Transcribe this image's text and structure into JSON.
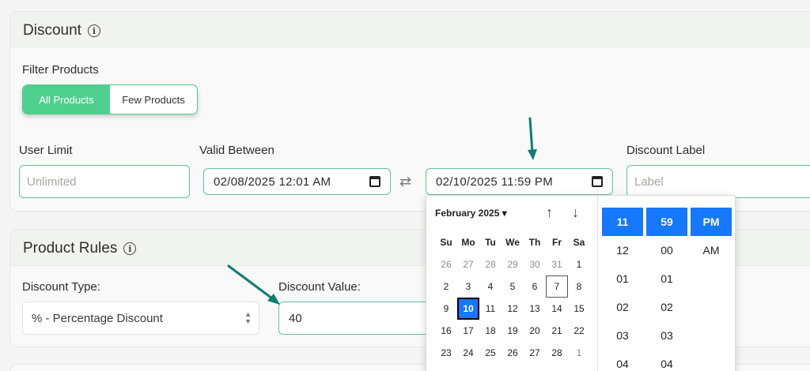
{
  "discount": {
    "title": "Discount",
    "filter_label": "Filter Products",
    "filter_options": [
      "All Products",
      "Few Products"
    ],
    "user_limit_label": "User Limit",
    "user_limit_placeholder": "Unlimited",
    "valid_between_label": "Valid Between",
    "start_datetime": "02/08/2025 12:01 AM",
    "end_datetime": "02/10/2025 11:59 PM",
    "discount_label_label": "Discount Label",
    "discount_label_placeholder": "Label"
  },
  "product_rules": {
    "title": "Product Rules",
    "discount_type_label": "Discount Type:",
    "discount_type_value": "% - Percentage Discount",
    "discount_value_label": "Discount Value:",
    "discount_value": "40"
  },
  "picker": {
    "month_label": "February 2025 ▾",
    "weekdays": [
      "Su",
      "Mo",
      "Tu",
      "We",
      "Th",
      "Fr",
      "Sa"
    ],
    "days": [
      [
        "26",
        "27",
        "28",
        "29",
        "30",
        "31",
        "1"
      ],
      [
        "2",
        "3",
        "4",
        "5",
        "6",
        "7",
        "8"
      ],
      [
        "9",
        "10",
        "11",
        "12",
        "13",
        "14",
        "15"
      ],
      [
        "16",
        "17",
        "18",
        "19",
        "20",
        "21",
        "22"
      ],
      [
        "23",
        "24",
        "25",
        "26",
        "27",
        "28",
        "1"
      ]
    ],
    "selected_day": "10",
    "today_day": "7",
    "hours": [
      "11",
      "12",
      "01",
      "02",
      "03",
      "04"
    ],
    "minutes": [
      "59",
      "00",
      "01",
      "02",
      "03",
      "04"
    ],
    "meridiem": [
      "PM",
      "AM"
    ]
  },
  "colors": {
    "accent_green": "#4fcf8e",
    "selection_blue": "#1677ff",
    "annotation_teal": "#0f7d73"
  }
}
